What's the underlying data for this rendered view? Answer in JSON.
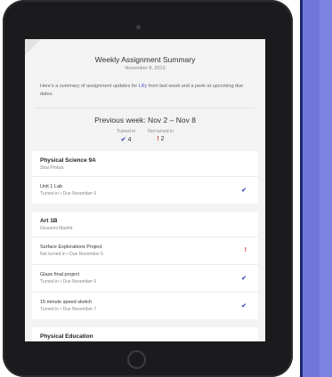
{
  "summary": {
    "title": "Weekly Assignment Summary",
    "date": "November 8, 2019",
    "intro_before": "Here's a summary of assignment updates for ",
    "intro_name": "Lilly",
    "intro_after": " from last week and a peek at upcoming due dates."
  },
  "previous_week": {
    "label": "Previous week: Nov 2 – Nov 8",
    "turned_in_label": "Turned in",
    "turned_in_count": "4",
    "not_turned_in_label": "Not turned in",
    "not_turned_in_count": "2"
  },
  "courses": [
    {
      "name": "Physical Science 9A",
      "teacher": "Shai Pinhas",
      "assignments": [
        {
          "name": "Unit 1 Lab",
          "status": "Turned in • Due November 6",
          "icon": "check-icon"
        }
      ]
    },
    {
      "name": "Art 1B",
      "teacher": "Giovanni Madrid",
      "assignments": [
        {
          "name": "Surface Explorations Project",
          "status": "Not turned in • Due November 5",
          "icon": "exclamation-icon"
        },
        {
          "name": "Glaze final project",
          "status": "Turned in • Due November 6",
          "icon": "check-icon"
        },
        {
          "name": "15 minute speed sketch",
          "status": "Turned in • Due November 7",
          "icon": "check-icon"
        }
      ]
    },
    {
      "name": "Physical Education",
      "teacher": "",
      "assignments": []
    }
  ],
  "icons": {
    "check": "✔",
    "exclamation": "!"
  },
  "colors": {
    "accent": "#4a55b8",
    "alert": "#d13438",
    "side_stripe": "#6f78d8"
  }
}
